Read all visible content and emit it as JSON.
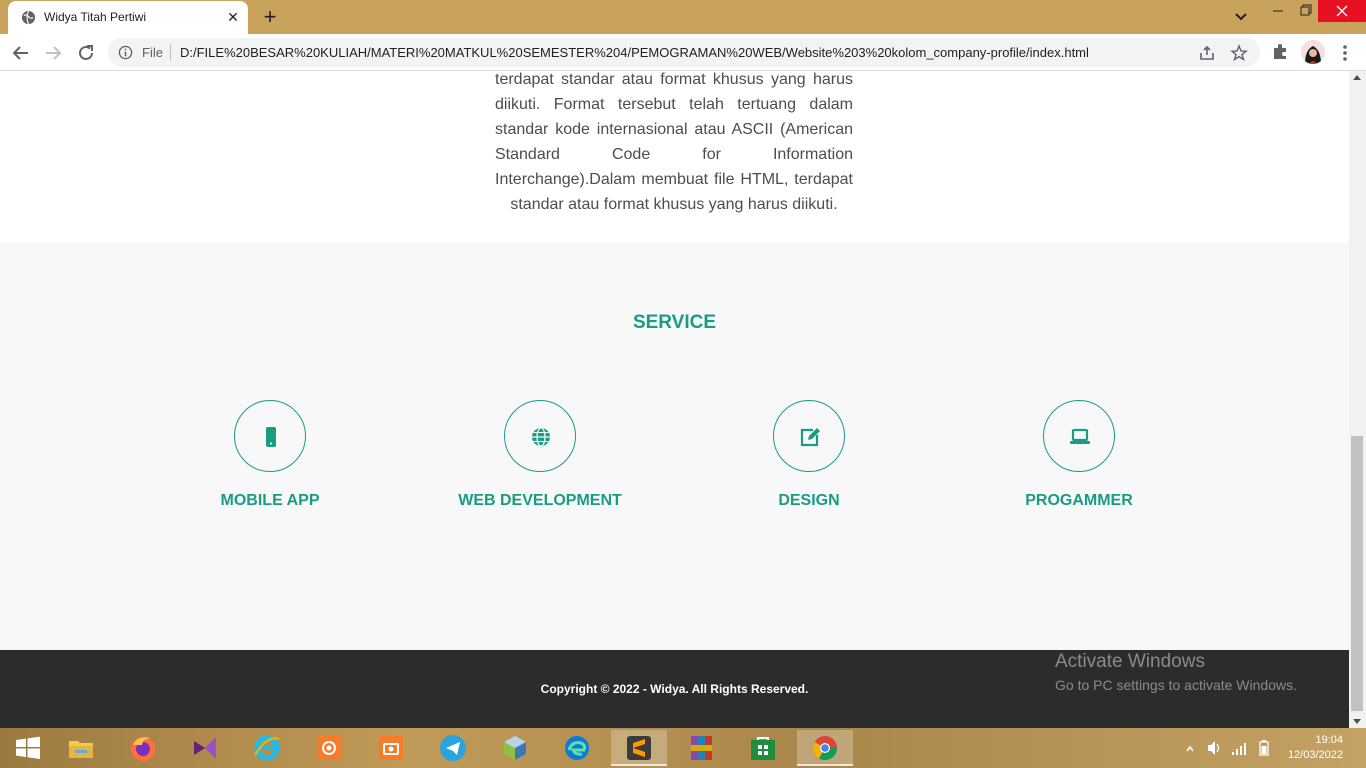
{
  "browser": {
    "tab_title": "Widya Titah Pertiwi",
    "tab_close": "✕",
    "new_tab": "+",
    "file_label": "File",
    "url": "D:/FILE%20BESAR%20KULIAH/MATERI%20MATKUL%20SEMESTER%204/PEMOGRAMAN%20WEB/Website%203%20kolom_company-profile/index.html"
  },
  "page": {
    "about_text": "terdapat standar atau format khusus yang harus diikuti. Format tersebut telah tertuang dalam standar kode internasional atau ASCII (American Standard Code for Information Interchange).Dalam membuat file HTML, terdapat standar atau format khusus yang harus diikuti.",
    "service_title": "SERVICE",
    "services": [
      {
        "label": "MOBILE APP",
        "icon": "mobile-icon"
      },
      {
        "label": "WEB DEVELOPMENT",
        "icon": "globe-icon"
      },
      {
        "label": "DESIGN",
        "icon": "edit-icon"
      },
      {
        "label": "PROGAMMER",
        "icon": "laptop-icon"
      }
    ],
    "footer": "Copyright © 2022 - Widya. All Rights Reserved.",
    "accent_color": "#1a9c83"
  },
  "watermark": {
    "title": "Activate Windows",
    "subtitle": "Go to PC settings to activate Windows."
  },
  "taskbar": {
    "apps": [
      "windows-start",
      "file-explorer",
      "firefox",
      "visual-studio",
      "internet-explorer",
      "screen-recorder",
      "screenshot",
      "telegram",
      "virtualbox",
      "edge",
      "sublime-text",
      "winrar",
      "store",
      "chrome"
    ],
    "time": "19:04",
    "date": "12/03/2022"
  }
}
